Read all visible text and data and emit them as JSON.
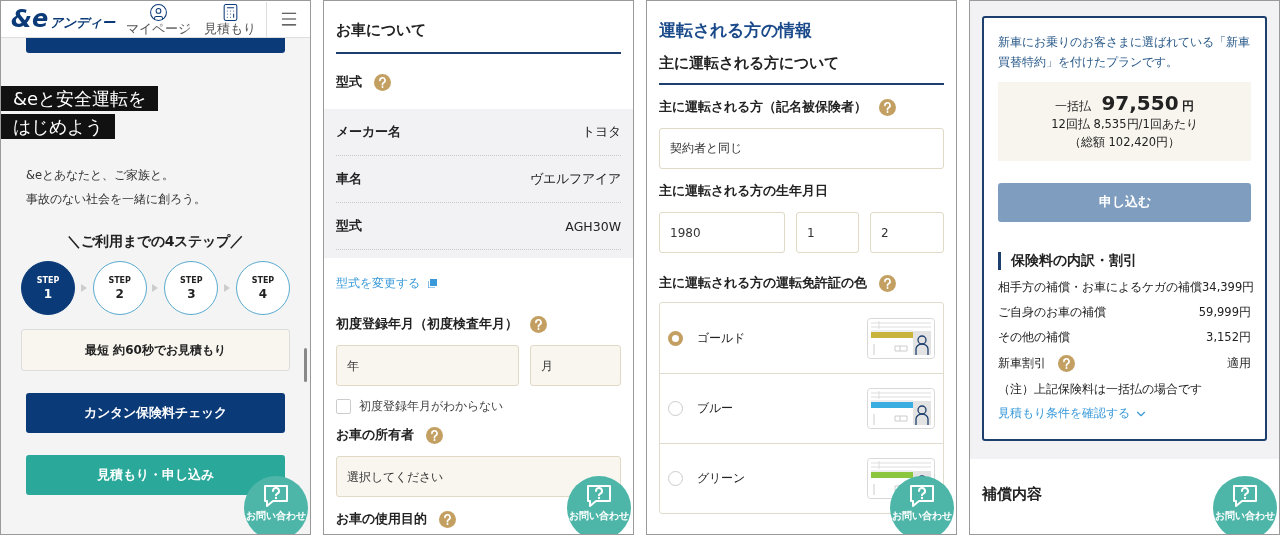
{
  "home_screen": {
    "logo": {
      "mark": "&e",
      "name": "アンディー"
    },
    "nav": [
      {
        "kind": "user",
        "label": "マイページ"
      },
      {
        "kind": "calculator",
        "label": "見積もり"
      }
    ],
    "headline": [
      "&eと安全運転を",
      "はじめよう"
    ],
    "intro": [
      "&eとあなたと、ご家族と。",
      "事故のない社会を一緒に創ろう。"
    ],
    "steps_title": "＼ご利用までの4ステップ／",
    "steps": [
      {
        "label": "STEP",
        "number": "1",
        "selected": true
      },
      {
        "label": "STEP",
        "number": "2",
        "selected": false
      },
      {
        "label": "STEP",
        "number": "3",
        "selected": false
      },
      {
        "label": "STEP",
        "number": "4",
        "selected": false
      }
    ],
    "step_note": "最短 約60秒でお見積もり",
    "buttons": [
      {
        "kind": "primary",
        "label": "カンタン保険料チェック"
      },
      {
        "kind": "secondary",
        "label": "見積もり・申し込み"
      }
    ],
    "contact": "お問い合わせ"
  },
  "car_screen": {
    "title": "お車について",
    "model_label": "型式",
    "specs": [
      {
        "label": "メーカー名",
        "value": "トヨタ"
      },
      {
        "label": "車名",
        "value": "ヴエルフアイア"
      },
      {
        "label": "型式",
        "value": "AGH30W"
      }
    ],
    "change_link": "型式を変更する",
    "registration": {
      "label": "初度登録年月（初度検査年月）",
      "fields": [
        {
          "placeholder": "年"
        },
        {
          "placeholder": "月"
        }
      ],
      "checkbox": {
        "label": "初度登録年月がわからない",
        "checked": false
      }
    },
    "owner": {
      "label": "お車の所有者",
      "placeholder": "選択してください"
    },
    "purpose": {
      "label": "お車の使用目的"
    },
    "contact": "お問い合わせ"
  },
  "driver_screen": {
    "title": "運転される方の情報",
    "subtitle": "主に運転される方について",
    "insured": {
      "label": "主に運転される方（記名被保険者）",
      "value": "契約者と同じ"
    },
    "birth": {
      "label": "主に運転される方の生年月日",
      "values": [
        "1980",
        "1",
        "2"
      ]
    },
    "license": {
      "label": "主に運転される方の運転免許証の色",
      "options": [
        {
          "label": "ゴールド",
          "selected": true,
          "color": "#c8b43c"
        },
        {
          "label": "ブルー",
          "selected": false,
          "color": "#3aaee0"
        },
        {
          "label": "グリーン",
          "selected": false,
          "color": "#8cc63f"
        }
      ]
    },
    "contact": "お問い合わせ"
  },
  "quote_screen": {
    "description": "新車にお乗りのお客さまに選ばれている「新車買替特約」を付けたプランです。",
    "price": {
      "lump_label": "一括払",
      "amount": "97,550",
      "unit": "円",
      "installment": "12回払 8,535円/1回あたり",
      "total": "（総額 102,420円）"
    },
    "apply_button": {
      "label": "申し込む",
      "disabled": true
    },
    "breakdown_title": "保険料の内訳・割引",
    "rows": [
      {
        "label": "相手方の補償・お車によるケガの補償",
        "value": "34,399円",
        "help": false
      },
      {
        "label": "ご自身のお車の補償",
        "value": "59,999円",
        "help": false
      },
      {
        "label": "その他の補償",
        "value": "3,152円",
        "help": false
      },
      {
        "label": "新車割引",
        "value": "適用",
        "help": true
      }
    ],
    "note": "（注）上記保険料は一括払の場合です",
    "conditions_link": "見積もり条件を確認する",
    "coverage_title": "補償内容",
    "contact": "お問い合わせ"
  }
}
